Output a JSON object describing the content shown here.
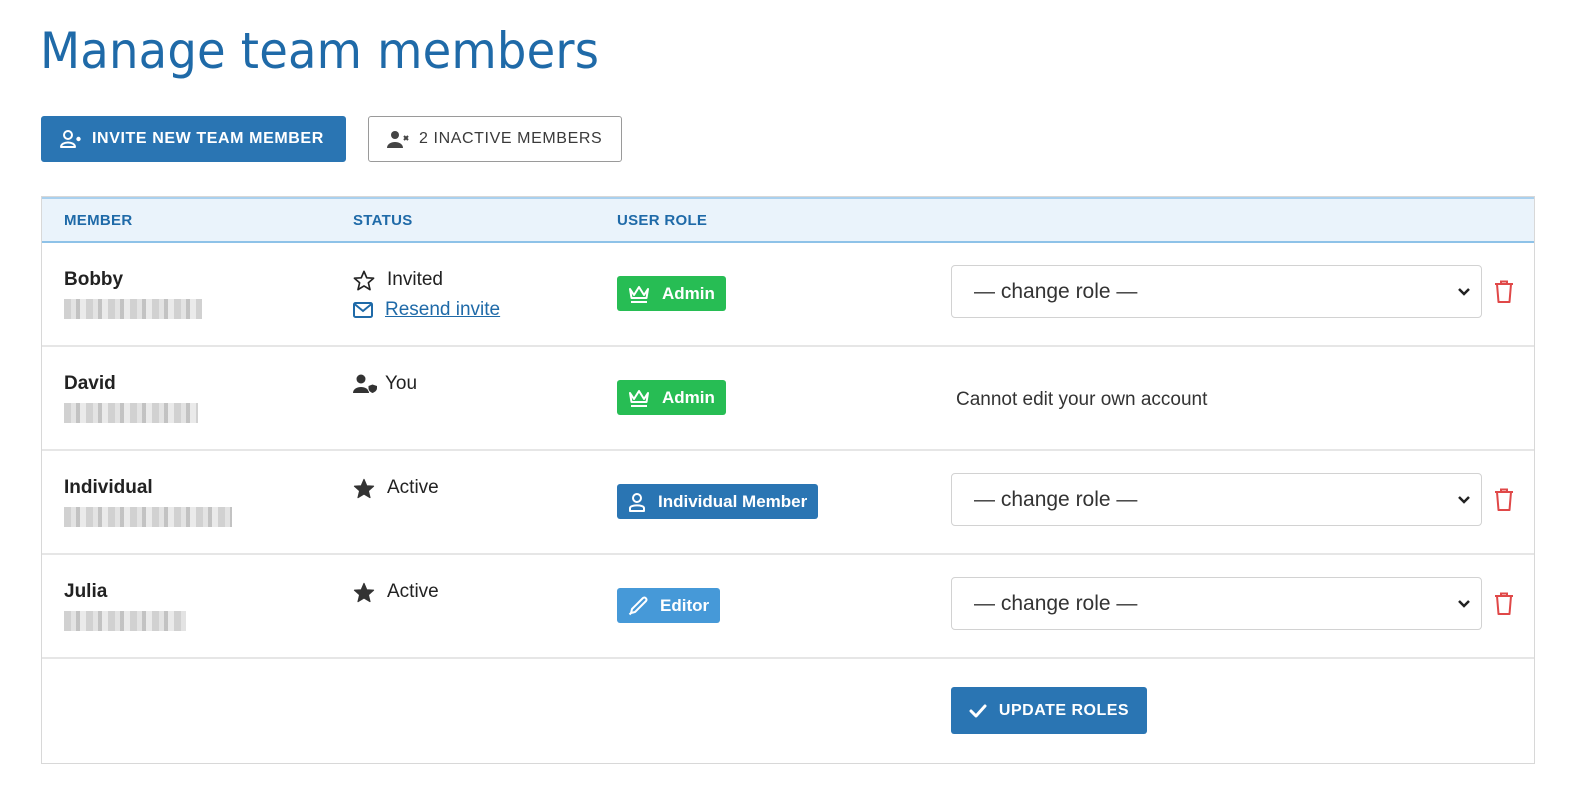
{
  "page": {
    "title": "Manage team members"
  },
  "toolbar": {
    "invite_label": "INVITE NEW TEAM MEMBER",
    "inactive_label": "2 INACTIVE MEMBERS"
  },
  "table": {
    "headers": {
      "member": "MEMBER",
      "status": "STATUS",
      "role": "USER ROLE"
    },
    "rows": [
      {
        "name": "Bobby",
        "email": "[redacted]",
        "status": "Invited",
        "status_icon": "star-outline-icon",
        "resend_label": "Resend invite",
        "role": "Admin",
        "role_icon": "crown-icon",
        "role_color": "#27bd54",
        "change_role": "— change role —",
        "editable": true
      },
      {
        "name": "David",
        "email": "[redacted]",
        "status": "You",
        "status_icon": "user-shield-icon",
        "role": "Admin",
        "role_icon": "crown-icon",
        "role_color": "#27bd54",
        "note": "Cannot edit your own account",
        "editable": false
      },
      {
        "name": "Individual",
        "email": "[redacted]",
        "status": "Active",
        "status_icon": "star-solid-icon",
        "role": "Individual Member",
        "role_icon": "user-icon",
        "role_color": "#2a75b3",
        "change_role": "— change role —",
        "editable": true
      },
      {
        "name": "Julia",
        "email": "[redacted]",
        "status": "Active",
        "status_icon": "star-solid-icon",
        "role": "Editor",
        "role_icon": "pen-icon",
        "role_color": "#4699d8",
        "change_role": "— change role —",
        "editable": true
      }
    ],
    "update_label": "UPDATE ROLES"
  },
  "colors": {
    "primary": "#2a75b3",
    "title": "#1f6aa8",
    "admin": "#27bd54",
    "editor": "#4699d8",
    "danger": "#e04848",
    "header_bg": "#eaf3fb"
  }
}
